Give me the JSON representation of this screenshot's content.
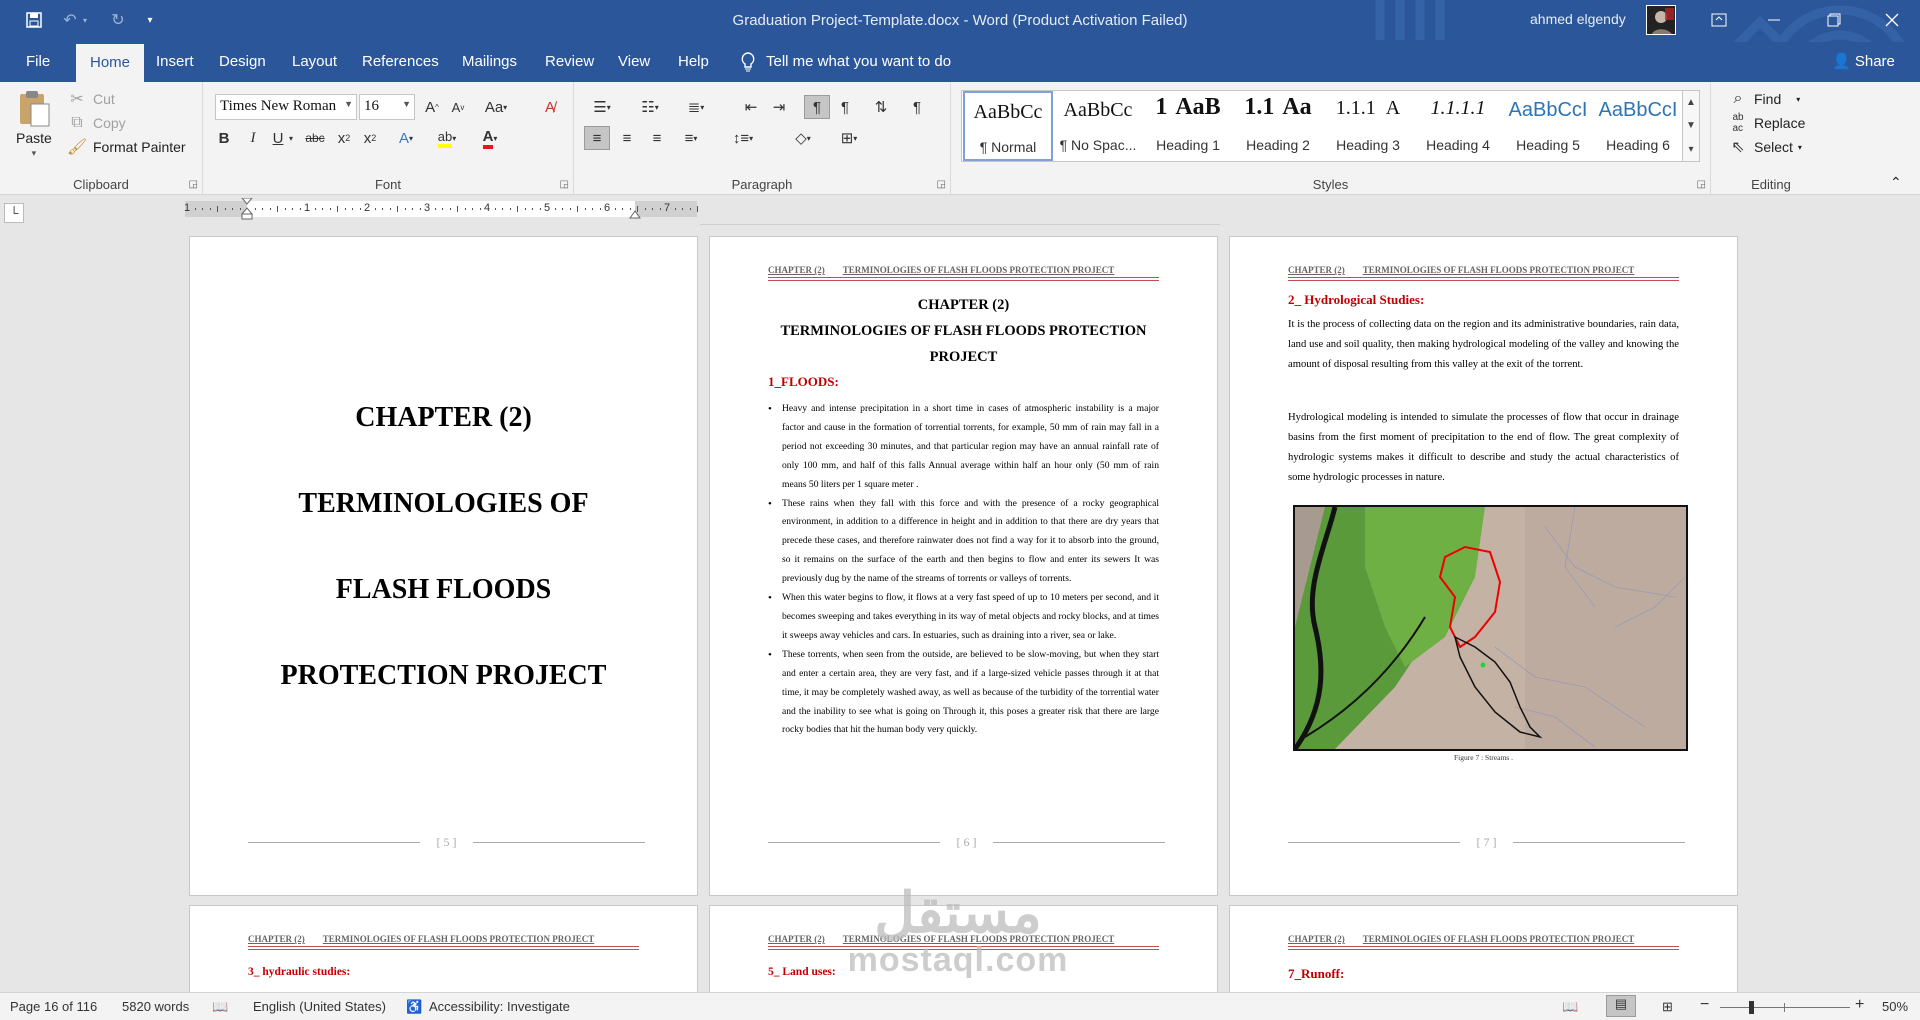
{
  "window": {
    "title": "Graduation Project-Template.docx  -  Word (Product Activation Failed)",
    "user": "ahmed elgendy",
    "share": "Share"
  },
  "tabs": [
    "File",
    "Home",
    "Insert",
    "Design",
    "Layout",
    "References",
    "Mailings",
    "Review",
    "View",
    "Help"
  ],
  "tellme": "Tell me what you want to do",
  "clipboard": {
    "paste": "Paste",
    "cut": "Cut",
    "copy": "Copy",
    "format_painter": "Format Painter",
    "label": "Clipboard"
  },
  "font": {
    "name": "Times New Roman",
    "size": "16",
    "label": "Font"
  },
  "paragraph": {
    "label": "Paragraph"
  },
  "styles": {
    "label": "Styles",
    "items": [
      {
        "preview": "AaBbCc",
        "name": "¶ Normal"
      },
      {
        "preview": "AaBbCc",
        "name": "¶ No Spac..."
      },
      {
        "preview": "1",
        "name": "Heading 1"
      },
      {
        "preview": "AaB",
        "name": "Heading 2"
      },
      {
        "preview": "1.1",
        "name": "Heading 2"
      },
      {
        "preview": "Aa",
        "name": "Heading 3"
      },
      {
        "preview": "1.1.1",
        "name": "Heading 3"
      },
      {
        "preview": "A",
        "name": "Heading 4"
      },
      {
        "preview": "1.1.1.1",
        "name": "Heading 4"
      },
      {
        "preview": "AaBbCcI",
        "name": "Heading 5"
      },
      {
        "preview": "AaBbCcI",
        "name": "Heading 6"
      }
    ]
  },
  "editing": {
    "find": "Find",
    "replace": "Replace",
    "select": "Select",
    "label": "Editing"
  },
  "ruler": {
    "numbers": [
      "1",
      "1",
      "2",
      "3",
      "4",
      "5",
      "6",
      "7"
    ]
  },
  "header_text": {
    "chapter": "CHAPTER (2)",
    "title": "TERMINOLOGIES OF FLASH FLOODS PROTECTION PROJECT"
  },
  "pages": {
    "p5": {
      "lines": [
        "CHAPTER (2)",
        "TERMINOLOGIES OF",
        "FLASH FLOODS",
        "PROTECTION PROJECT"
      ],
      "num": "5"
    },
    "p6": {
      "heading": [
        "CHAPTER (2)",
        "TERMINOLOGIES OF FLASH FLOODS PROTECTION",
        "PROJECT"
      ],
      "section": "1_FLOODS:",
      "bullets": [
        "Heavy and intense precipitation in a short time in cases of atmospheric instability is a major factor and cause in the formation of torrential torrents, for example, 50 mm of rain may fall in a period not exceeding 30 minutes, and that particular region may have an annual rainfall rate of only 100 mm, and half of this falls Annual average within half an hour only (50 mm of rain means 50 liters per 1 square meter .",
        "These rains when they fall with this force and with the presence of a rocky geographical environment, in addition to a difference in height and in addition to that there are dry years that precede these cases, and therefore rainwater does not find a way for it to absorb into the ground, so it remains on the surface of the earth and then begins to flow and enter its sewers It was previously dug by the name of the streams of torrents or valleys of torrents.",
        "When this water begins to flow, it flows at a very fast speed of up to 10 meters per second, and it becomes sweeping and takes everything in its way of metal objects and rocky blocks, and at times it sweeps away vehicles and cars. In estuaries, such as draining into a river, sea or lake.",
        "These torrents, when seen from the outside, are believed to be slow-moving, but when they start and enter a certain area, they are very fast, and if a large-sized vehicle passes through it at that time, it may be completely washed away, as well as because of the turbidity of the torrential water and the inability to see what is going on Through it, this poses a greater risk that there are large rocky bodies that hit the human body very quickly."
      ],
      "num": "6"
    },
    "p7": {
      "section": "2_ Hydrological Studies:",
      "paras": [
        "It is the process of collecting data on the region and its administrative boundaries, rain data, land use and soil quality, then making hydrological modeling of the valley and knowing the amount of disposal resulting from this valley at the exit of the torrent.",
        "Hydrological modeling is intended to simulate the processes of flow that occur in drainage basins from the first moment of precipitation to the end of flow. The great complexity of hydrologic systems makes it difficult to describe and study the actual characteristics of some hydrologic processes in nature."
      ],
      "caption": "Figure 7 : Streams .",
      "num": "7"
    },
    "p16": {
      "section": "3_ hydraulic studies:"
    },
    "p17": {
      "section": "5_ Land uses:"
    },
    "p18": {
      "section": "7_Runoff:"
    }
  },
  "watermark": {
    "arabic": "مستقل",
    "latin": "mostaql.com"
  },
  "status": {
    "page": "Page 16 of 116",
    "words": "5820 words",
    "language": "English (United States)",
    "accessibility": "Accessibility: Investigate",
    "zoom": "50%"
  }
}
